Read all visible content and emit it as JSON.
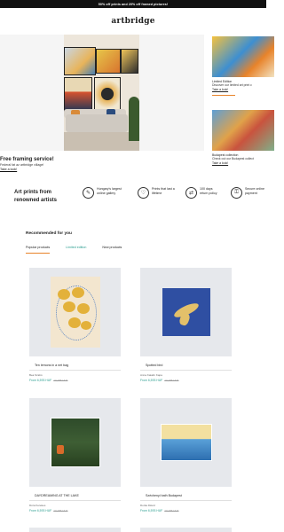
{
  "promo": "50% off prints and 20% off framed pictures!",
  "logo": "artbridge",
  "hero": {
    "title": "Free framing service!",
    "subtitle": "Federal fat az artbridge village!",
    "link": "Take a look!"
  },
  "side": [
    {
      "title": "Limited Edition",
      "subtitle": "Discover our limited art print c",
      "link": "Take a look!"
    },
    {
      "title": "Budapest collection",
      "subtitle": "Check out our Budapest collect",
      "link": "Take a look!"
    }
  ],
  "features": {
    "title": "Art prints from renowned artists",
    "items": [
      {
        "icon": "brush-icon",
        "label": "Hungary's largest online gallery"
      },
      {
        "icon": "heart-hand-icon",
        "label": "Prints that last a lifetime"
      },
      {
        "icon": "return-truck-icon",
        "label": "100 days return policy"
      },
      {
        "icon": "secure-payment-icon",
        "label": "Secure online payment"
      }
    ]
  },
  "recommended": {
    "title": "Recommended for you",
    "tabs": [
      "Popular products",
      "Limited edition",
      "New products"
    ]
  },
  "products": [
    {
      "title": "Ten lemons in a net bag",
      "artist": "Bea Szabó",
      "price": "From 6,593 HUF",
      "old_price": "13,186 HUF"
    },
    {
      "title": "Spotted bird",
      "artist": "Anna Katalin Kapa",
      "price": "From 6,593 HUF",
      "old_price": "13,186 HUF"
    },
    {
      "title": "DAYDREAMING AT THE LAKE",
      "artist": "Dóra Kerekes",
      "price": "From 6,593 HUF",
      "old_price": "13,186 HUF"
    },
    {
      "title": "Széchenyi bath Budapest",
      "artist": "Dorka Dávid",
      "price": "From 6,593 HUF",
      "old_price": "13,186 HUF"
    }
  ],
  "colors": {
    "accent": "#e8832a",
    "teal": "#2a9d8f",
    "promo_bg": "#111111"
  }
}
